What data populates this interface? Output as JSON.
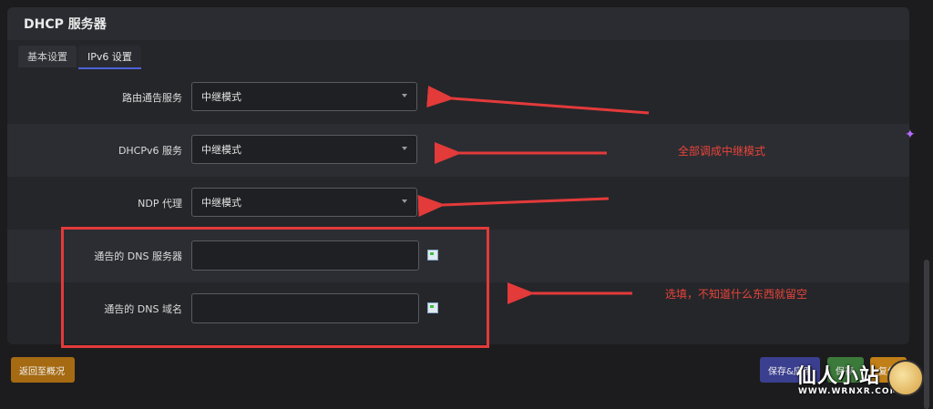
{
  "panel": {
    "title": "DHCP 服务器"
  },
  "tabs": [
    {
      "label": "基本设置",
      "active": false
    },
    {
      "label": "IPv6 设置",
      "active": true
    }
  ],
  "fields": {
    "ra": {
      "label": "路由通告服务",
      "value": "中继模式"
    },
    "dhcpv6": {
      "label": "DHCPv6 服务",
      "value": "中继模式"
    },
    "ndp": {
      "label": "NDP 代理",
      "value": "中继模式"
    },
    "dns_server": {
      "label": "通告的 DNS 服务器",
      "value": ""
    },
    "dns_domain": {
      "label": "通告的 DNS 域名",
      "value": ""
    }
  },
  "buttons": {
    "back": "返回至概况",
    "save_apply": "保存&应用",
    "save": "保存",
    "reset": "复位"
  },
  "annotations": {
    "note_relay": "全部调成中继模式",
    "note_optional": "选填，不知道什么东西就留空"
  },
  "watermark": {
    "title": "仙人小站",
    "url": "WWW.WRNXR.COM"
  },
  "colors": {
    "annotation": "#e33a3a",
    "accent": "#4b63d8"
  }
}
